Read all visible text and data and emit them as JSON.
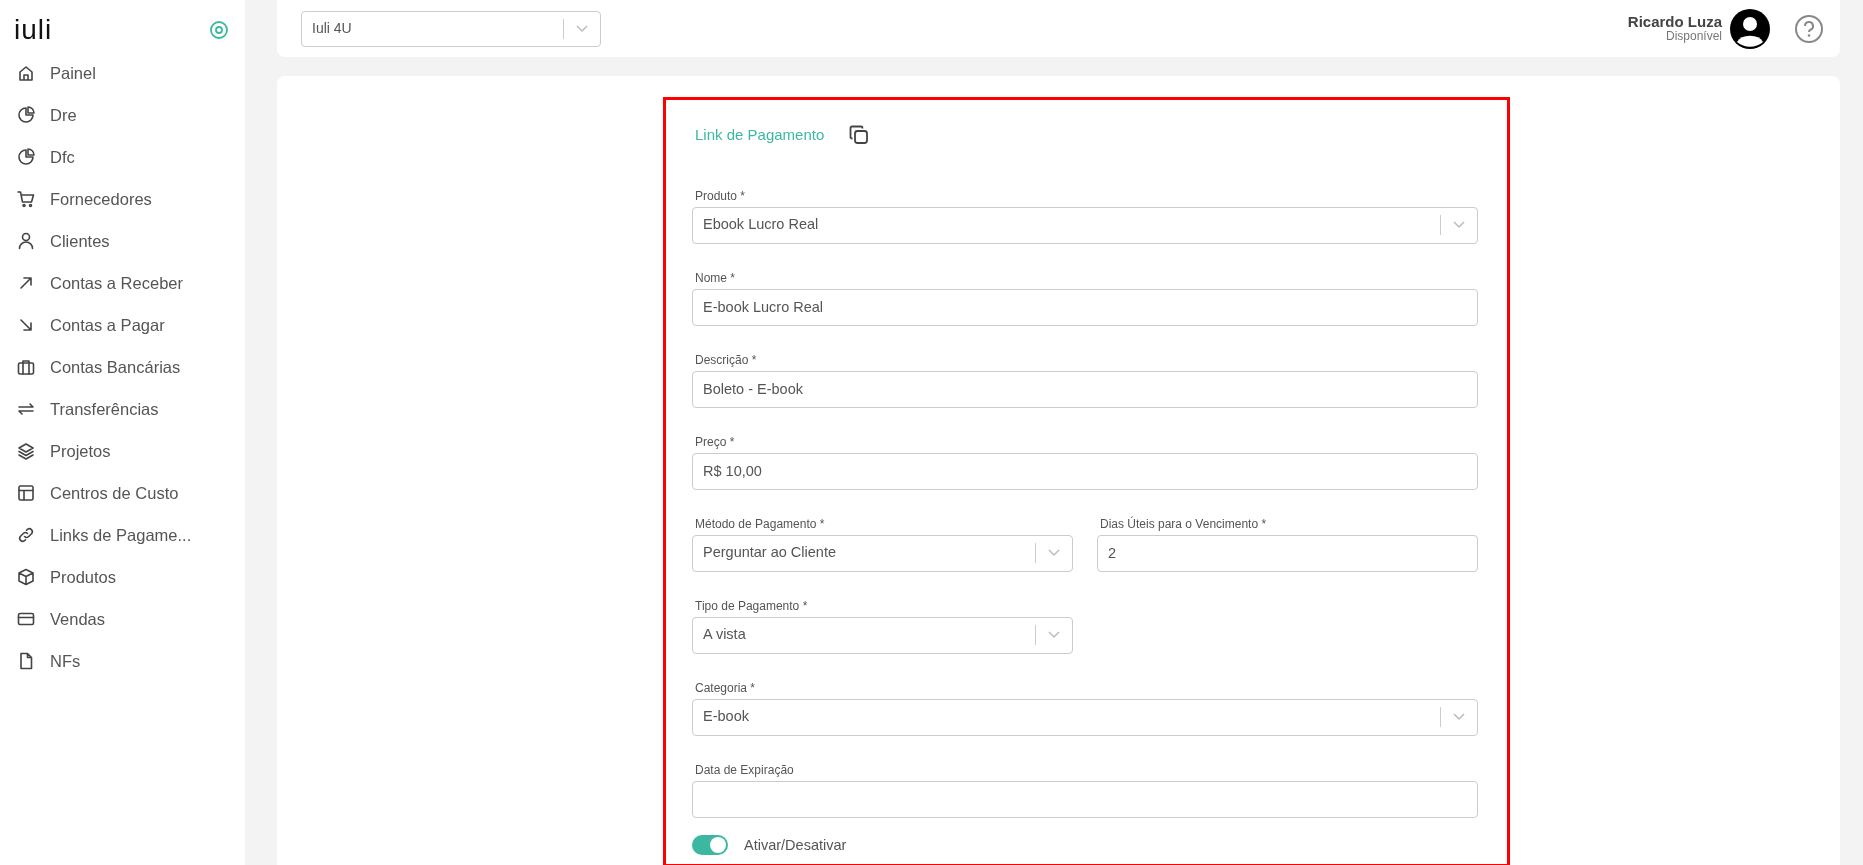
{
  "sidebar": {
    "logo": "iuli",
    "items": [
      {
        "label": "Painel"
      },
      {
        "label": "Dre"
      },
      {
        "label": "Dfc"
      },
      {
        "label": "Fornecedores"
      },
      {
        "label": "Clientes"
      },
      {
        "label": "Contas a Receber"
      },
      {
        "label": "Contas a Pagar"
      },
      {
        "label": "Contas Bancárias"
      },
      {
        "label": "Transferências"
      },
      {
        "label": "Projetos"
      },
      {
        "label": "Centros de Custo"
      },
      {
        "label": "Links de Pagame..."
      },
      {
        "label": "Produtos"
      },
      {
        "label": "Vendas"
      },
      {
        "label": "NFs"
      }
    ]
  },
  "header": {
    "company_select": {
      "value": "Iuli 4U"
    },
    "user": {
      "name": "Ricardo Luza",
      "status": "Disponível"
    }
  },
  "form": {
    "title": "Link de Pagamento",
    "rows": [
      [
        {
          "kind": "select",
          "label": "Produto *",
          "value": "Ebook Lucro Real"
        }
      ],
      [
        {
          "kind": "text",
          "label": "Nome *",
          "value": "E-book Lucro Real"
        }
      ],
      [
        {
          "kind": "text",
          "label": "Descrição *",
          "value": "Boleto - E-book"
        }
      ],
      [
        {
          "kind": "text",
          "label": "Preço *",
          "value": "R$ 10,00"
        }
      ],
      [
        {
          "kind": "select",
          "label": "Método de Pagamento *",
          "value": "Perguntar ao Cliente"
        },
        {
          "kind": "text",
          "label": "Dias Úteis para o Vencimento *",
          "value": "2"
        }
      ],
      [
        {
          "kind": "select",
          "label": "Tipo de Pagamento *",
          "value": "A vista"
        }
      ],
      [
        {
          "kind": "select",
          "label": "Categoria *",
          "value": "E-book"
        }
      ],
      [
        {
          "kind": "text",
          "label": "Data de Expiração"
        }
      ]
    ],
    "toggle": {
      "label": "Ativar/Desativar",
      "on": true
    }
  }
}
